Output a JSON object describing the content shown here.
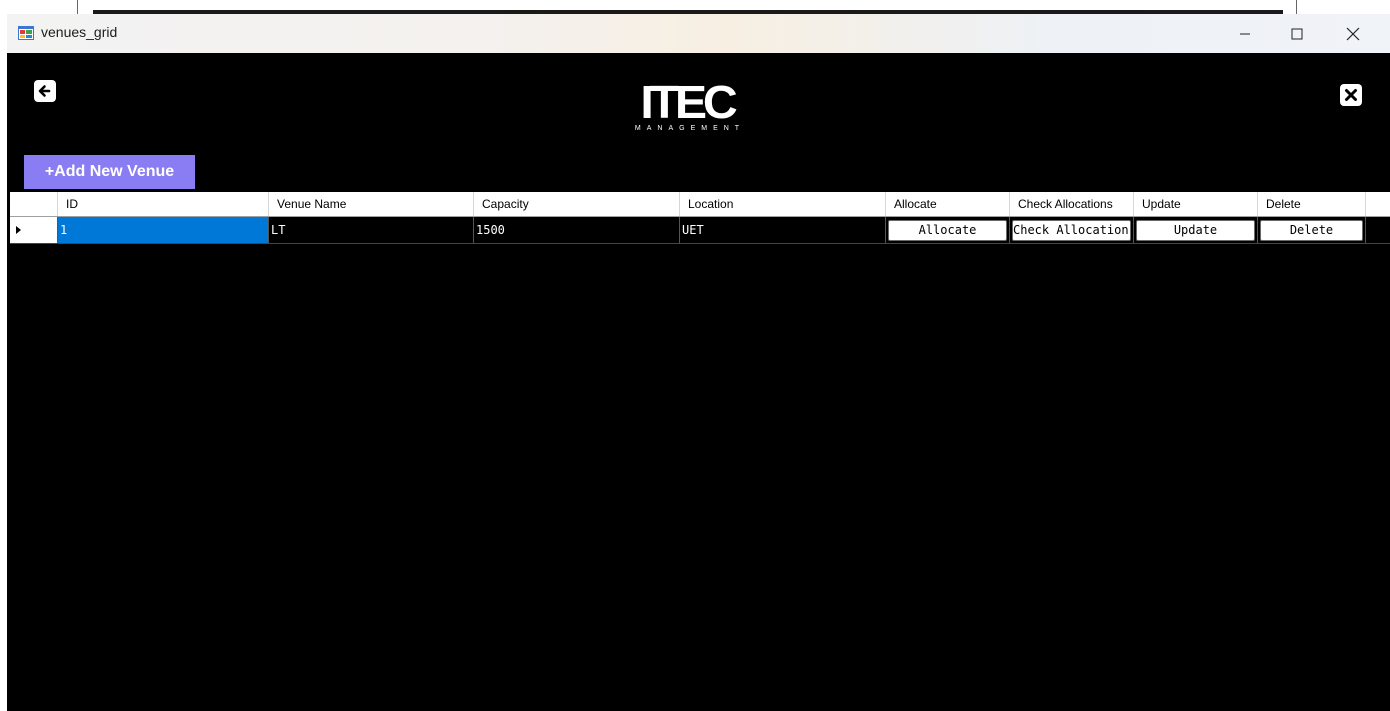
{
  "window": {
    "title": "venues_grid",
    "minimize_glyph": "—",
    "maximize_glyph": "☐",
    "close_glyph": "✕"
  },
  "header": {
    "logo_main": "ITEC",
    "logo_sub": "MANAGEMENT",
    "back_icon": "arrow-left-icon",
    "close_icon": "close-square-icon"
  },
  "toolbar": {
    "add_label": "+Add New Venue"
  },
  "colors": {
    "accent": "#8a7cf2",
    "background": "#000000",
    "selection": "#0078d7"
  },
  "grid": {
    "columns": [
      "ID",
      "Venue Name",
      "Capacity",
      "Location",
      "Allocate",
      "Check Allocations",
      "Update",
      "Delete"
    ],
    "rows": [
      {
        "id": "1",
        "venue_name": "LT",
        "capacity": "1500",
        "location": "UET",
        "allocate_label": "Allocate",
        "check_label": "Check Allocation",
        "update_label": "Update",
        "delete_label": "Delete"
      }
    ]
  }
}
